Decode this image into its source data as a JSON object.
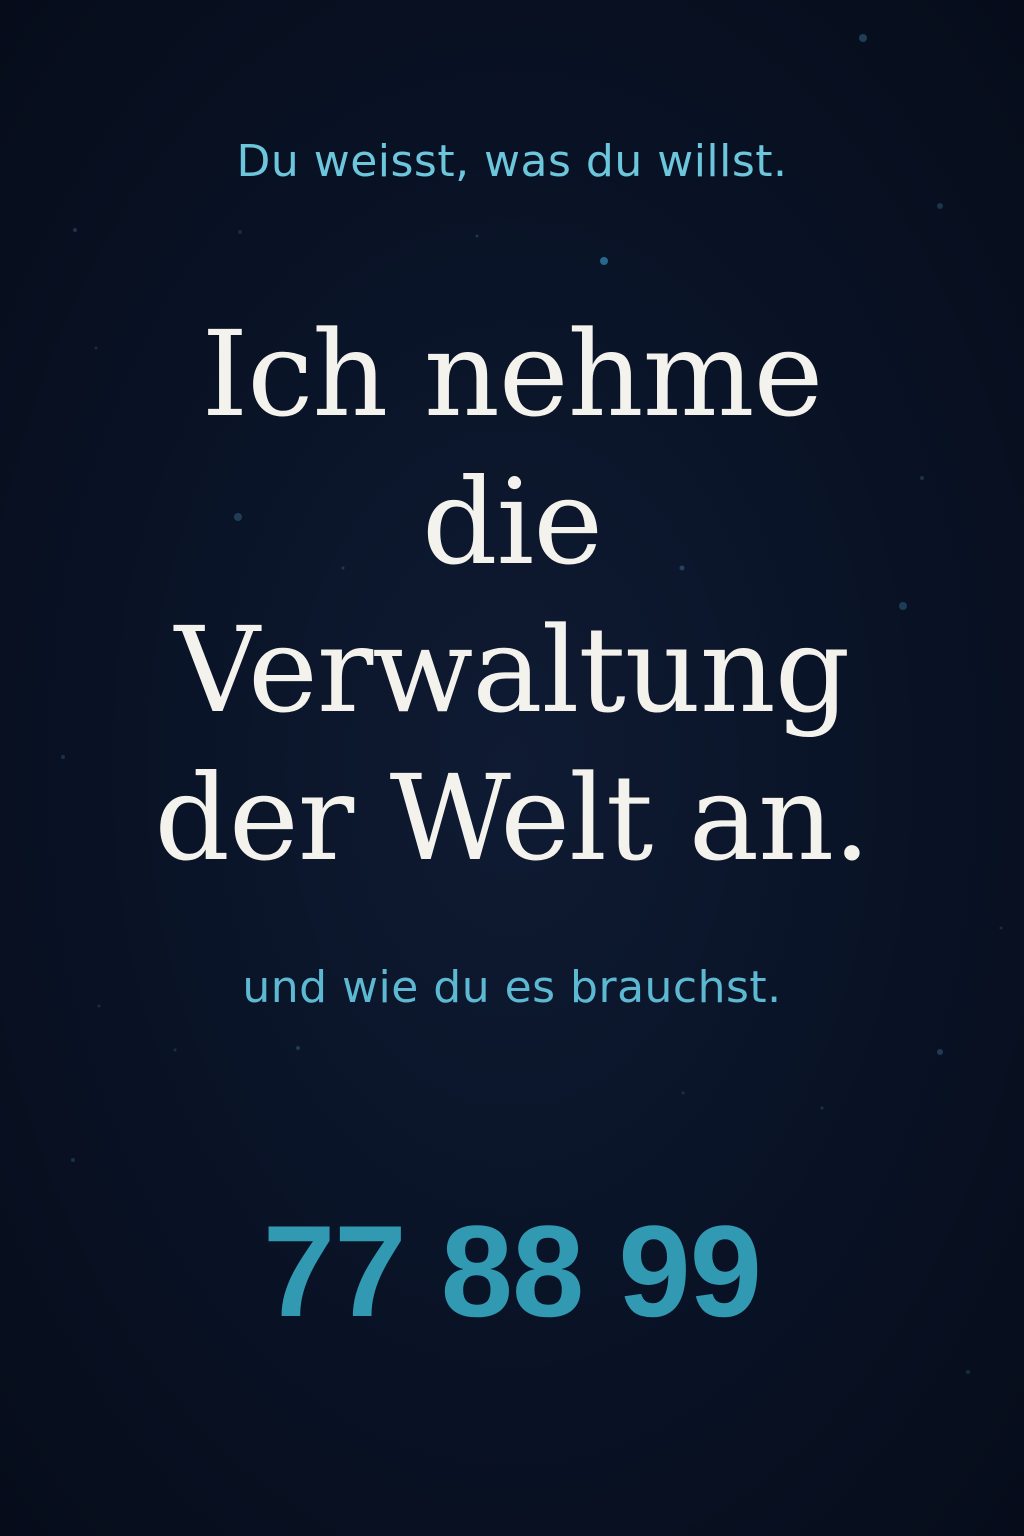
{
  "tagline_top": "Du weisst, was du willst.",
  "headline": {
    "line1": "Ich nehme",
    "line2": "die",
    "line3": "Verwaltung",
    "line4": "der Welt an."
  },
  "tagline_bottom": "und wie du es brauchst.",
  "phone_number": "77 88 99",
  "colors": {
    "background": "#0a1428",
    "accent_light": "#6cc6dc",
    "accent": "#3299b2",
    "headline": "#f4f2ec"
  }
}
